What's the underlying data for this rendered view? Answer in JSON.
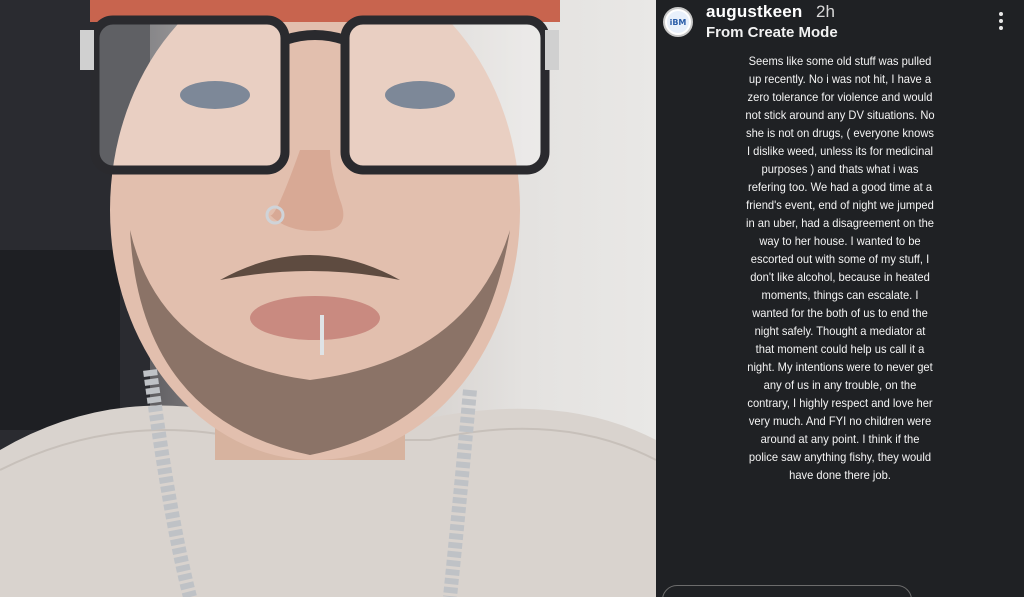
{
  "photo": {
    "description_icon": "selfie-photo"
  },
  "story": {
    "username": "augustkeen",
    "time_ago": "2h",
    "subtitle": "From Create Mode",
    "avatar_text": "iBM",
    "more_icon": "more-vertical-icon",
    "body": "Seems like some old stuff was pulled up recently. No i was not hit, I have a zero tolerance for violence and would not stick around any DV situations. No she is not on drugs, ( everyone knows I dislike weed, unless its for medicinal purposes ) and thats what i was refering too. We had a good time at a friend's event, end of night we jumped in an uber, had a disagreement on the way to her house. I wanted to be escorted out with some of my stuff, I don't like alcohol, because in heated moments, things can escalate. I wanted for the both of us to end the night safely. Thought a mediator at that moment could help us call it a night. My intentions were to never get any of us in any trouble, on the contrary, I highly respect and love her very much. And FYI no children were around at any point. I think if the police saw anything fishy, they would have done there job."
  },
  "colors": {
    "story_bg": "#1f2124",
    "text": "#ffffff"
  }
}
